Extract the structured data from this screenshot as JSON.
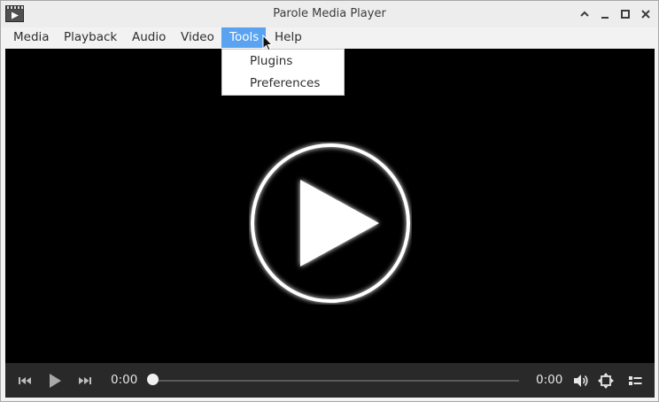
{
  "window": {
    "title": "Parole Media Player"
  },
  "menubar": {
    "items": [
      {
        "label": "Media"
      },
      {
        "label": "Playback"
      },
      {
        "label": "Audio"
      },
      {
        "label": "Video"
      },
      {
        "label": "Tools",
        "active": true
      },
      {
        "label": "Help"
      }
    ]
  },
  "tools_menu": {
    "items": [
      {
        "label": "Plugins"
      },
      {
        "label": "Preferences"
      }
    ]
  },
  "player": {
    "elapsed": "0:00",
    "duration": "0:00",
    "progress": 0,
    "state": "stopped"
  },
  "icons": {
    "app": "clapperboard-icon",
    "big_play": "play-circle-icon",
    "prev": "skip-previous-icon",
    "play": "play-icon",
    "next": "skip-next-icon",
    "volume": "volume-icon",
    "fullscreen": "fullscreen-icon",
    "playlist": "playlist-icon"
  },
  "colors": {
    "menu_highlight": "#5aa3f0",
    "video_bg": "#000000",
    "controls_bg": "#292929"
  }
}
